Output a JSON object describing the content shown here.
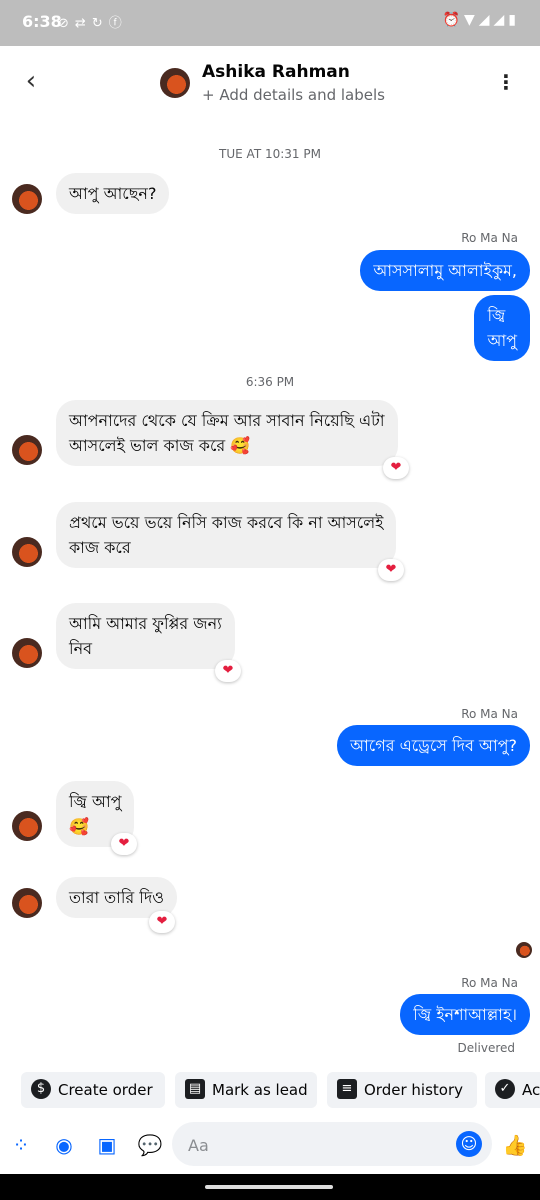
{
  "status_bar": {
    "time": "6:38",
    "left_icons": [
      "do-not-disturb-icon",
      "signal-arrows-icon",
      "hotspot-icon",
      "facebook-icon"
    ],
    "right_icons": [
      "alarm-icon",
      "wifi-icon",
      "signal-icon",
      "signal-icon-2",
      "battery-icon"
    ]
  },
  "header": {
    "name": "Ashika Rahman",
    "subtitle": "+ Add details and labels"
  },
  "timestamps": [
    "TUE AT 10:31 PM",
    "6:36 PM"
  ],
  "sender_label": "Ro Ma Na",
  "messages": [
    {
      "direction": "in",
      "text": "আপু আছেন?"
    },
    {
      "direction": "out",
      "text": "আসসালামু আলাইকুম,"
    },
    {
      "direction": "out",
      "text": "জ্বি\nআপু"
    },
    {
      "direction": "in",
      "text": "আপনাদের থেকে যে ক্রিম আর সাবান নিয়েছি এটা\nআসলেই ভাল কাজ করে 🥰",
      "reaction": "❤"
    },
    {
      "direction": "in",
      "text": "প্রথমে ভয়ে ভয়ে নিসি কাজ করবে কি না আসলেই\nকাজ করে",
      "reaction": "❤"
    },
    {
      "direction": "in",
      "text": "আমি আমার ফুপ্পির জন্য\nনিব",
      "reaction": "❤"
    },
    {
      "direction": "out",
      "text": "আগের এড্রেসে দিব আপু?"
    },
    {
      "direction": "in",
      "text": "জ্বি আপু\n🥰",
      "reaction": "❤"
    },
    {
      "direction": "in",
      "text": "তারা তারি দিও",
      "reaction": "❤"
    },
    {
      "direction": "out",
      "text": "জ্বি ইনশাআল্লাহ।"
    }
  ],
  "delivery_status": "Delivered",
  "quick_actions": [
    {
      "label": "Create order",
      "icon": "dollar-icon"
    },
    {
      "label": "Mark as lead",
      "icon": "contact-card-icon"
    },
    {
      "label": "Order history",
      "icon": "list-icon"
    },
    {
      "label": "Ac",
      "icon": "check-circle-icon"
    }
  ],
  "composer": {
    "placeholder": "Aa",
    "icons": [
      "apps-icon",
      "camera-icon",
      "gallery-icon",
      "chat-bubble-icon",
      "emoji-icon",
      "like-icon"
    ]
  },
  "colors": {
    "accent": "#0866ff",
    "incoming_bubble": "#f0f0f0",
    "status_bar": "#bdbdbd",
    "reaction": "#e41e3f"
  }
}
